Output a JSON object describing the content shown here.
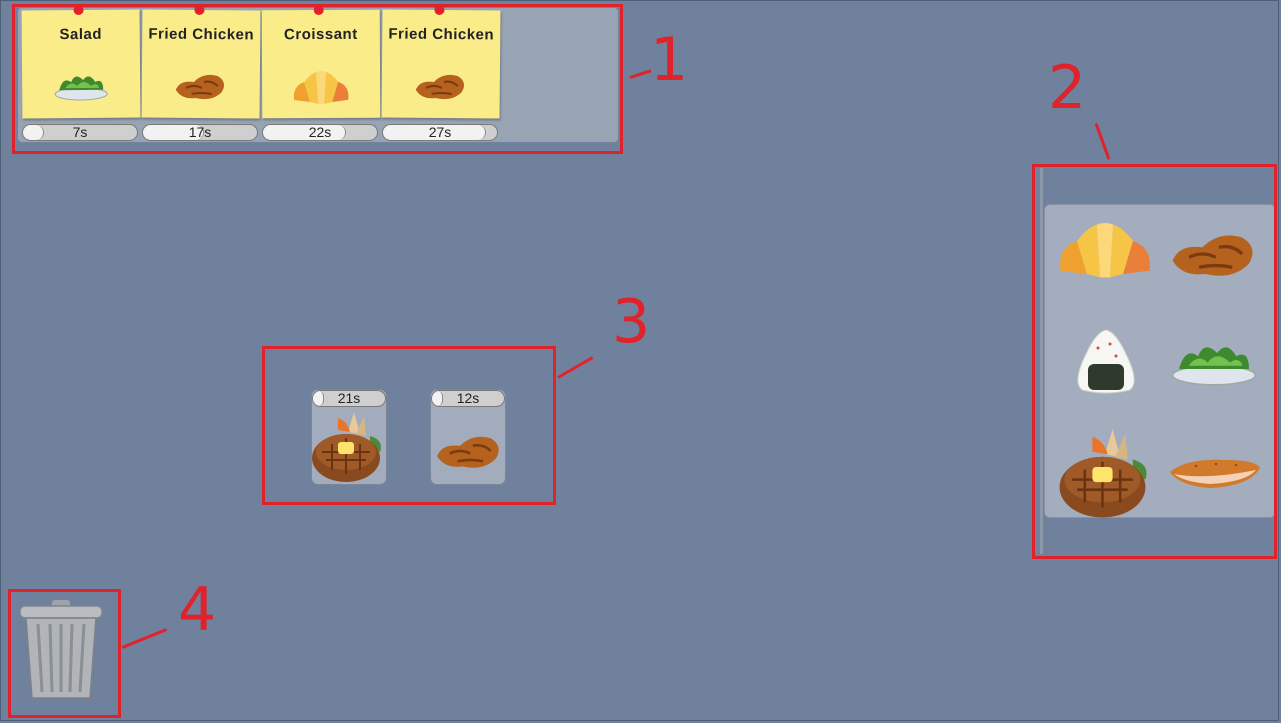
{
  "annotations": [
    "1",
    "2",
    "3",
    "4"
  ],
  "orders": [
    {
      "name": "Salad",
      "food": "salad-icon",
      "timer": "7s",
      "progress": 0.15
    },
    {
      "name": "Fried Chicken",
      "food": "fried-chicken-icon",
      "timer": "17s",
      "progress": 0.5
    },
    {
      "name": "Croissant",
      "food": "croissant-icon",
      "timer": "22s",
      "progress": 0.7
    },
    {
      "name": "Fried Chicken",
      "food": "fried-chicken-icon",
      "timer": "27s",
      "progress": 0.85
    }
  ],
  "ingredients": [
    "croissant-icon",
    "fried-chicken-icon",
    "onigiri-icon",
    "salad-icon",
    "hamburg-steak-icon",
    "cutlet-icon"
  ],
  "station": [
    {
      "food": "hamburg-steak-icon",
      "timer": "21s",
      "progress": 0.1
    },
    {
      "food": "fried-chicken-icon",
      "timer": "12s",
      "progress": 0.1
    }
  ],
  "trash": "trash-can-icon",
  "colors": {
    "background": "#6f819d",
    "annotation": "#e0222b",
    "ticket": "#fbec8a"
  }
}
